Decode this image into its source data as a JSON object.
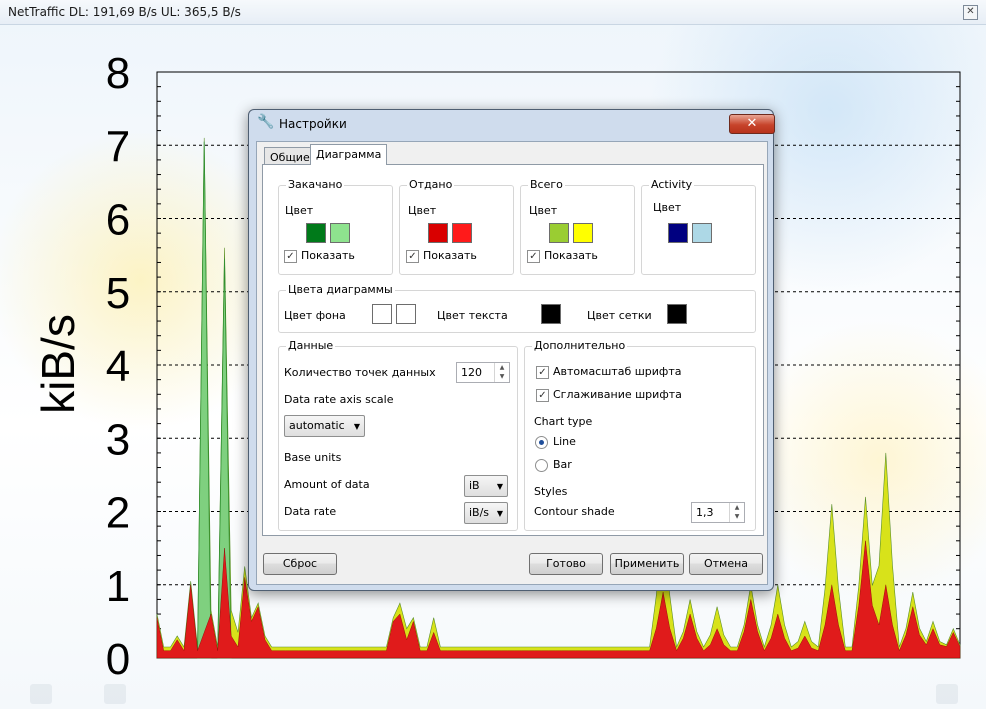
{
  "window": {
    "title": "NetTraffic DL: 191,69 B/s UL: 365,5 B/s",
    "close_glyph": "✕"
  },
  "chart_data": {
    "type": "area",
    "ylabel": "kiB/s",
    "ylim": [
      0,
      8
    ],
    "yticks": [
      "0",
      "1",
      "2",
      "3",
      "4",
      "5",
      "6",
      "7",
      "8"
    ],
    "grid": true,
    "colors": {
      "downloaded": "#e01b1b",
      "uploaded": "#d8e21a",
      "downloaded_edge": "#2f8f2f",
      "activity_spike": "#7fd07f"
    },
    "series": [
      {
        "name": "Закачано",
        "values": [
          0.55,
          0.1,
          0.1,
          0.25,
          0.1,
          1.0,
          0.1,
          0.1,
          0.6,
          0.1,
          1.5,
          0.3,
          0.15,
          1.1,
          0.5,
          0.7,
          0.25,
          0.1,
          0.1,
          0.1,
          0.1,
          0.1,
          0.1,
          0.1,
          0.1,
          0.1,
          0.1,
          0.1,
          0.1,
          0.1,
          0.1,
          0.1,
          0.1,
          0.1,
          0.1,
          0.5,
          0.6,
          0.25,
          0.5,
          0.1,
          0.1,
          0.35,
          0.1,
          0.1,
          0.1,
          0.1,
          0.1,
          0.1,
          0.1,
          0.1,
          0.1,
          0.1,
          0.1,
          0.1,
          0.1,
          0.1,
          0.1,
          0.1,
          0.1,
          0.1,
          0.1,
          0.1,
          0.1,
          0.1,
          0.1,
          0.1,
          0.1,
          0.1,
          0.1,
          0.1,
          0.1,
          0.1,
          0.1,
          0.1,
          0.1,
          0.1,
          0.1,
          0.1,
          0.1,
          0.1,
          0.1,
          0.1,
          0.1,
          0.1,
          0.1,
          0.1,
          0.1,
          0.1,
          0.1,
          0.1,
          0.1,
          0.1,
          0.1,
          0.1,
          0.1,
          0.1,
          0.1,
          0.1,
          0.1,
          0.1,
          0.1,
          0.1,
          0.1,
          0.1,
          0.1,
          0.1,
          0.1,
          0.1,
          0.1,
          0.1,
          0.1,
          0.1,
          0.1,
          0.1,
          0.1,
          0.1,
          0.1,
          0.1,
          0.1,
          0.1
        ]
      },
      {
        "name": "Отдано",
        "values": [
          0.4,
          0.1,
          0.1,
          0.2,
          0.1,
          0.9,
          0.1,
          0.1,
          0.5,
          0.1,
          1.8,
          0.6,
          0.3,
          1.2,
          0.5,
          0.5,
          0.25,
          0.1,
          0.1,
          0.1,
          0.1,
          0.1,
          0.1,
          0.1,
          0.1,
          0.1,
          0.1,
          0.1,
          0.1,
          0.1,
          0.1,
          0.1,
          0.1,
          0.1,
          0.1,
          0.4,
          0.7,
          0.35,
          0.5,
          0.1,
          0.1,
          0.5,
          0.1,
          0.1,
          0.1,
          0.1,
          0.1,
          0.1,
          0.1,
          0.1,
          0.1,
          0.1,
          0.1,
          0.1,
          0.1,
          0.1,
          0.1,
          0.1,
          0.1,
          0.1,
          0.1,
          0.1,
          0.1,
          0.1,
          0.1,
          0.1,
          0.1,
          0.1,
          0.1,
          0.1,
          0.1,
          0.1,
          0.1,
          0.1,
          0.1,
          0.1,
          0.1,
          0.1,
          0.1,
          0.1,
          0.1,
          0.1,
          0.1,
          0.1,
          0.1,
          0.1,
          0.1,
          0.1,
          0.1,
          0.1,
          0.1,
          0.1,
          0.1,
          0.1,
          0.1,
          0.1,
          0.1,
          0.1,
          0.1,
          0.1,
          0.1,
          0.1,
          0.1,
          0.1,
          0.1,
          0.1,
          0.1,
          0.1,
          0.1,
          0.1,
          0.1,
          0.1,
          0.1,
          0.1,
          0.1,
          0.1,
          0.1,
          0.1,
          0.1,
          0.1
        ]
      }
    ],
    "visible_peaks_right": [
      {
        "x": 0.63,
        "down": 0.9,
        "up": 1.0
      },
      {
        "x": 0.66,
        "down": 0.6,
        "up": 0.2
      },
      {
        "x": 0.7,
        "down": 0.4,
        "up": 0.3
      },
      {
        "x": 0.74,
        "down": 0.8,
        "up": 0.2
      },
      {
        "x": 0.77,
        "down": 0.6,
        "up": 0.4
      },
      {
        "x": 0.81,
        "down": 0.3,
        "up": 0.2
      },
      {
        "x": 0.84,
        "down": 1.0,
        "up": 1.1
      },
      {
        "x": 0.88,
        "down": 1.6,
        "up": 0.6
      },
      {
        "x": 0.91,
        "down": 1.0,
        "up": 1.8
      },
      {
        "x": 0.94,
        "down": 0.7,
        "up": 0.2
      },
      {
        "x": 0.97,
        "down": 0.4,
        "up": 0.1
      },
      {
        "x": 0.99,
        "down": 0.35,
        "up": 0.05
      }
    ],
    "spikes": [
      {
        "x": 0.06,
        "down": 0.35,
        "up": 6.75,
        "edge": 7.05
      },
      {
        "x": 0.08,
        "down": 0.2,
        "up": 5.4,
        "edge": 5.45
      }
    ]
  },
  "dialog": {
    "title": "Настройки",
    "close_glyph": "✕",
    "tabs": [
      "Общие",
      "Диаграмма"
    ],
    "groups": {
      "downloaded": {
        "caption": "Закачано",
        "color_label": "Цвет",
        "colors": [
          "#007a1a",
          "#8ee38e"
        ],
        "show_label": "Показать",
        "show_checked": true
      },
      "uploaded": {
        "caption": "Отдано",
        "color_label": "Цвет",
        "colors": [
          "#d90000",
          "#ff1a1a"
        ],
        "show_label": "Показать",
        "show_checked": true
      },
      "total": {
        "caption": "Всего",
        "color_label": "Цвет",
        "colors": [
          "#9acd32",
          "#ffff00"
        ],
        "show_label": "Показать",
        "show_checked": true
      },
      "activity": {
        "caption": "Activity",
        "color_label": "Цвет",
        "colors": [
          "#000080",
          "#add8e6"
        ]
      }
    },
    "chart_colors": {
      "caption": "Цвета диаграммы",
      "bg_label": "Цвет фона",
      "bg_colors": [
        "#ffffff",
        "#ffffff"
      ],
      "text_label": "Цвет текста",
      "text_color": "#000000",
      "grid_label": "Цвет сетки",
      "grid_color": "#000000"
    },
    "data": {
      "caption": "Данные",
      "points_label": "Количество точек данных",
      "points_value": "120",
      "axis_scale_label": "Data rate axis scale",
      "axis_scale_value": "automatic",
      "base_units_label": "Base units",
      "amount_label": "Amount of data",
      "amount_value": "iB",
      "rate_label": "Data rate",
      "rate_value": "iB/s"
    },
    "extra": {
      "caption": "Дополнительно",
      "autoscale_label": "Автомасштаб шрифта",
      "autoscale_checked": true,
      "smoothing_label": "Сглаживание шрифта",
      "smoothing_checked": true,
      "chart_type_label": "Chart type",
      "line_label": "Line",
      "line_selected": true,
      "bar_label": "Bar",
      "bar_selected": false,
      "styles_label": "Styles",
      "contour_label": "Contour shade",
      "contour_value": "1,3"
    },
    "buttons": {
      "reset": "Сброс",
      "done": "Готово",
      "apply": "Применить",
      "cancel": "Отмена"
    },
    "check_glyph": "✓",
    "dropdown_glyph": "▼",
    "spin_glyph_up": "▲",
    "spin_glyph_down": "▼"
  }
}
